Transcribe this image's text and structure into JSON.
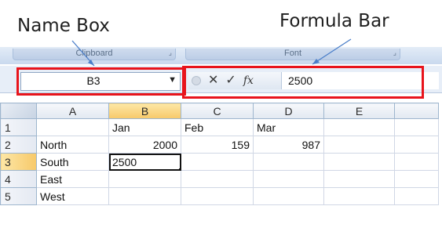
{
  "annotations": {
    "name_box": "Name Box",
    "formula_bar": "Formula Bar"
  },
  "ribbon": {
    "groups": [
      {
        "label": "Clipboard"
      },
      {
        "label": "Font"
      }
    ]
  },
  "name_box": {
    "value": "B3"
  },
  "formula_bar": {
    "cancel_glyph": "✕",
    "enter_glyph": "✓",
    "insert_function_glyph": "fx",
    "value": "2500"
  },
  "sheet": {
    "columns": [
      "A",
      "B",
      "C",
      "D",
      "E"
    ],
    "selected_column": "B",
    "selected_row": "3",
    "rows": [
      {
        "header": "1",
        "cells": [
          "",
          "Jan",
          "Feb",
          "Mar",
          ""
        ]
      },
      {
        "header": "2",
        "cells": [
          "North",
          "2000",
          "159",
          "987",
          ""
        ]
      },
      {
        "header": "3",
        "cells": [
          "South",
          "2500",
          "",
          "",
          ""
        ]
      },
      {
        "header": "4",
        "cells": [
          "East",
          "",
          "",
          "",
          ""
        ]
      },
      {
        "header": "5",
        "cells": [
          "West",
          "",
          "",
          "",
          ""
        ]
      }
    ]
  },
  "colors": {
    "annotation_red": "#e8141c",
    "selection_header": "#f7c96a",
    "ribbon_blue": "#c9d9ee"
  },
  "icons": [
    "dropdown-arrow-icon",
    "cancel-icon",
    "enter-check-icon",
    "insert-function-icon"
  ]
}
